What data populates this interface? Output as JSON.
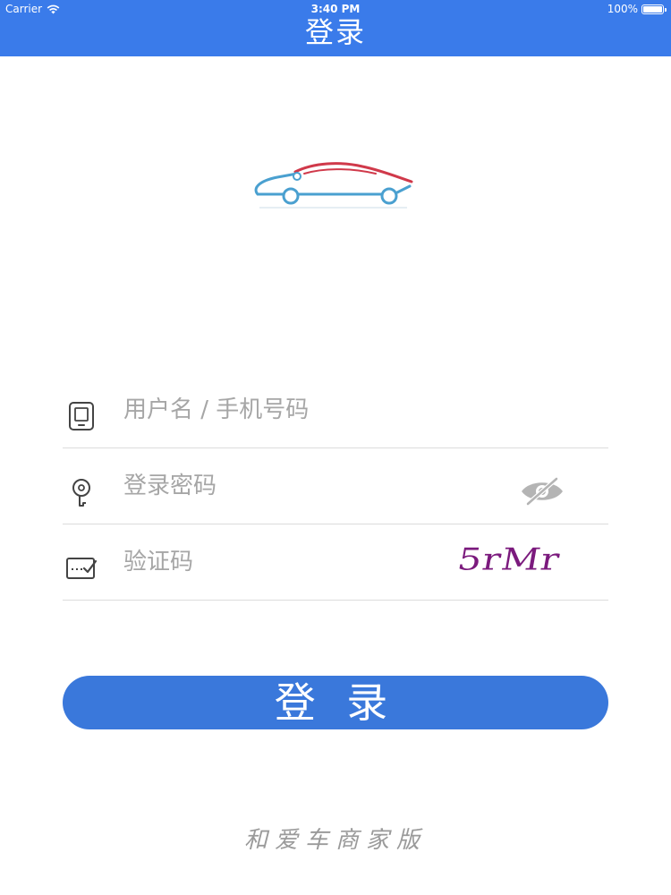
{
  "status_bar": {
    "carrier": "Carrier",
    "time": "3:40 PM",
    "battery_text": "100%",
    "battery_level": 1.0
  },
  "header": {
    "title": "登录"
  },
  "logo": {
    "icon": "car-logo-icon",
    "colors": {
      "roof": "#d0394a",
      "body": "#4aa0d0"
    }
  },
  "form": {
    "username": {
      "placeholder": "用户名 / 手机号码",
      "value": "",
      "icon": "phone-icon"
    },
    "password": {
      "placeholder": "登录密码",
      "value": "",
      "icon": "key-icon",
      "toggle_icon": "eye-hidden-icon"
    },
    "captcha": {
      "placeholder": "验证码",
      "value": "",
      "icon": "code-edit-icon",
      "captcha_text": "5rMr"
    }
  },
  "login_button": {
    "label": "登 录"
  },
  "footer": {
    "text": "和爱车商家版"
  },
  "colors": {
    "accent": "#3a7bea",
    "button": "#3a78db",
    "placeholder": "#a6a6a6",
    "divider": "#dcdcdc",
    "captcha": "#7b1a7d"
  }
}
